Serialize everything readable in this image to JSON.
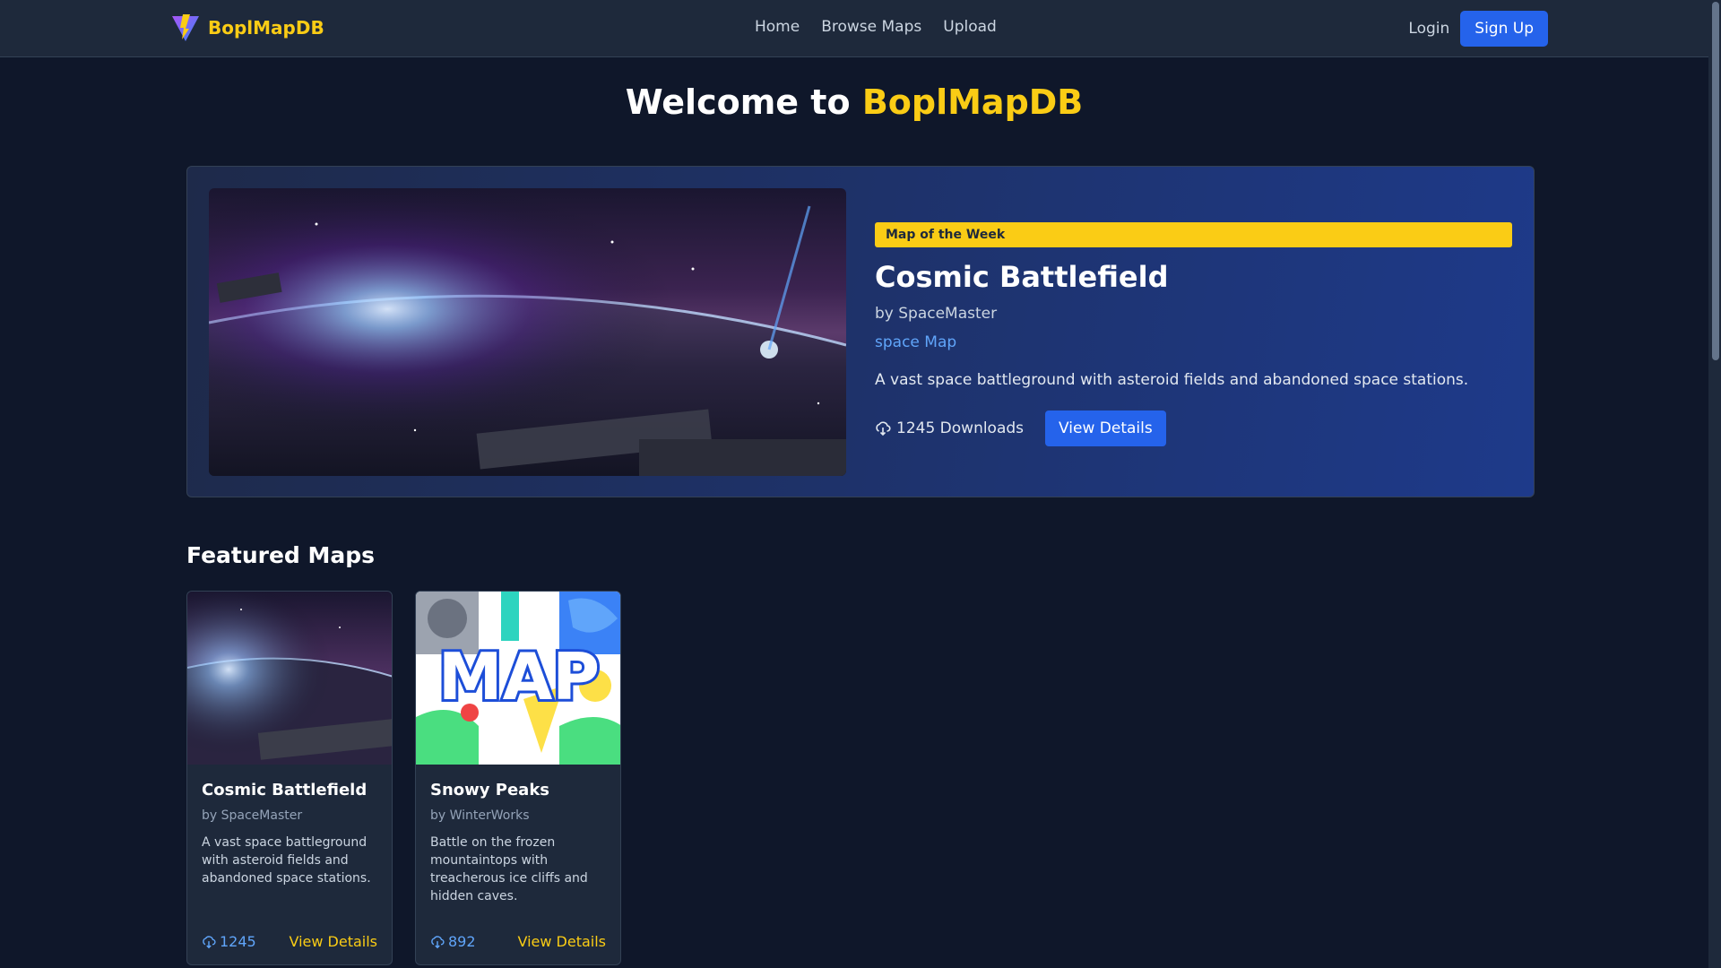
{
  "nav": {
    "brand": "BoplMapDB",
    "links": [
      "Home",
      "Browse Maps",
      "Upload"
    ],
    "login": "Login",
    "signup": "Sign Up"
  },
  "hero": {
    "welcome_prefix": "Welcome to ",
    "welcome_accent": "BoplMapDB"
  },
  "map_of_week": {
    "badge": "Map of the Week",
    "title": "Cosmic Battlefield",
    "author": "by SpaceMaster",
    "category": "space Map",
    "description": "A vast space battleground with asteroid fields and abandoned space stations.",
    "downloads": "1245 Downloads",
    "button": "View Details"
  },
  "featured": {
    "heading": "Featured Maps",
    "cards": [
      {
        "title": "Cosmic Battlefield",
        "author": "by SpaceMaster",
        "description": "A vast space battleground with asteroid fields and abandoned space stations.",
        "downloads": "1245",
        "link": "View Details"
      },
      {
        "title": "Snowy Peaks",
        "author": "by WinterWorks",
        "description": "Battle on the frozen mountaintops with treacherous ice cliffs and hidden caves.",
        "downloads": "892",
        "link": "View Details",
        "image_text": "MAP"
      }
    ]
  },
  "colors": {
    "background": "#0f172a",
    "navbar": "#1e293b",
    "accent_yellow": "#facc15",
    "primary_blue": "#2563eb",
    "link_blue": "#60a5fa"
  }
}
